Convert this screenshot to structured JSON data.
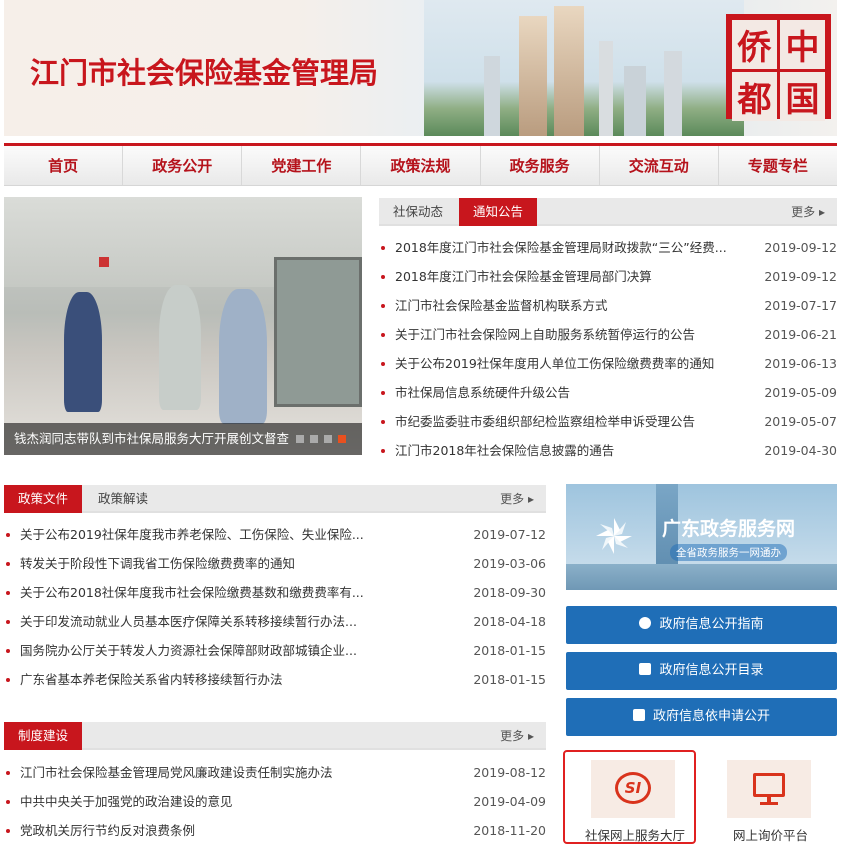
{
  "banner": {
    "title": "江门市社会保险基金管理局",
    "stamp_chars": [
      "侨",
      "中",
      "都",
      "国"
    ]
  },
  "nav": {
    "items": [
      "首页",
      "政务公开",
      "党建工作",
      "政策法规",
      "政务服务",
      "交流互动",
      "专题专栏"
    ]
  },
  "slideshow": {
    "caption": "钱杰润同志带队到市社保局服务大厅开展创文督查",
    "active_dot": 4
  },
  "news": {
    "tabs": [
      "社保动态",
      "通知公告"
    ],
    "active_tab": "通知公告",
    "more": "更多 ▸",
    "items": [
      {
        "title": "2018年度江门市社会保险基金管理局财政拨款“三公”经费...",
        "date": "2019-09-12"
      },
      {
        "title": "2018年度江门市社会保险基金管理局部门决算",
        "date": "2019-09-12"
      },
      {
        "title": "江门市社会保险基金监督机构联系方式",
        "date": "2019-07-17"
      },
      {
        "title": "关于江门市社会保险网上自助服务系统暂停运行的公告",
        "date": "2019-06-21"
      },
      {
        "title": "关于公布2019社保年度用人单位工伤保险缴费费率的通知",
        "date": "2019-06-13"
      },
      {
        "title": "市社保局信息系统硬件升级公告",
        "date": "2019-05-09"
      },
      {
        "title": "市纪委监委驻市委组织部纪检监察组检举申诉受理公告",
        "date": "2019-05-07"
      },
      {
        "title": "江门市2018年社会保险信息披露的通告",
        "date": "2019-04-30"
      }
    ]
  },
  "policy": {
    "tabs": [
      "政策文件",
      "政策解读"
    ],
    "active_tab": "政策文件",
    "more": "更多 ▸",
    "items": [
      {
        "title": "关于公布2019社保年度我市养老保险、工伤保险、失业保险...",
        "date": "2019-07-12"
      },
      {
        "title": "转发关于阶段性下调我省工伤保险缴费费率的通知",
        "date": "2019-03-06"
      },
      {
        "title": "关于公布2018社保年度我市社会保险缴费基数和缴费费率有...",
        "date": "2018-09-30"
      },
      {
        "title": "关于印发流动就业人员基本医疗保障关系转移接续暂行办法...",
        "date": "2018-04-18"
      },
      {
        "title": "国务院办公厅关于转发人力资源社会保障部财政部城镇企业...",
        "date": "2018-01-15"
      },
      {
        "title": "广东省基本养老保险关系省内转移接续暂行办法",
        "date": "2018-01-15"
      }
    ]
  },
  "system": {
    "tab": "制度建设",
    "more": "更多 ▸",
    "items": [
      {
        "title": "江门市社会保险基金管理局党风廉政建设责任制实施办法",
        "date": "2019-08-12"
      },
      {
        "title": "中共中央关于加强党的政治建设的意见",
        "date": "2019-04-09"
      },
      {
        "title": "党政机关厉行节约反对浪费条例",
        "date": "2018-11-20"
      }
    ]
  },
  "gd_banner": {
    "title": "广东政务服务网",
    "subtitle": "全省政务服务一网通办"
  },
  "buttons": {
    "guide": "政府信息公开指南",
    "catalog": "政府信息公开目录",
    "apply": "政府信息依申请公开"
  },
  "services": {
    "hall": {
      "label": "社保网上服务大厅",
      "logo": "SI"
    },
    "price": {
      "label": "网上询价平台"
    }
  },
  "colors": {
    "accent": "#c8161d",
    "button_blue": "#1f6eb7",
    "dot_active": "#e8501f"
  }
}
